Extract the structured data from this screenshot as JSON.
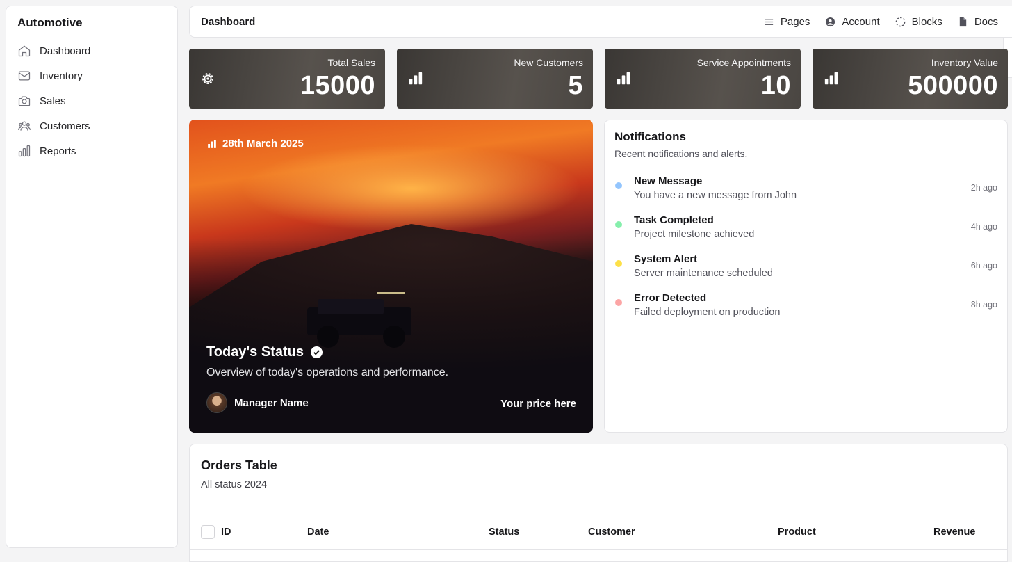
{
  "sidebar": {
    "brand": "Automotive",
    "items": [
      {
        "label": "Dashboard",
        "icon": "home-icon"
      },
      {
        "label": "Inventory",
        "icon": "mail-icon"
      },
      {
        "label": "Sales",
        "icon": "camera-icon"
      },
      {
        "label": "Customers",
        "icon": "users-icon"
      },
      {
        "label": "Reports",
        "icon": "bar-chart-icon"
      }
    ]
  },
  "topbar": {
    "title": "Dashboard",
    "links": [
      {
        "label": "Pages",
        "icon": "menu-icon"
      },
      {
        "label": "Account",
        "icon": "user-circle-icon"
      },
      {
        "label": "Blocks",
        "icon": "dashed-circle-icon"
      },
      {
        "label": "Docs",
        "icon": "file-icon"
      }
    ]
  },
  "stats": [
    {
      "label": "Total Sales",
      "value": "15000",
      "icon": "gear-icon"
    },
    {
      "label": "New Customers",
      "value": "5",
      "icon": "bar-chart-icon"
    },
    {
      "label": "Service Appointments",
      "value": "10",
      "icon": "bar-chart-icon"
    },
    {
      "label": "Inventory Value",
      "value": "500000",
      "icon": "bar-chart-icon"
    }
  ],
  "hero": {
    "date": "28th March 2025",
    "title": "Today's Status",
    "subtitle": "Overview of today's operations and performance.",
    "manager": "Manager Name",
    "price": "Your price here"
  },
  "notifications": {
    "title": "Notifications",
    "subtitle": "Recent notifications and alerts.",
    "items": [
      {
        "title": "New Message",
        "desc": "You have a new message from John",
        "time": "2h ago",
        "color": "#93c5fd"
      },
      {
        "title": "Task Completed",
        "desc": "Project milestone achieved",
        "time": "4h ago",
        "color": "#86efac"
      },
      {
        "title": "System Alert",
        "desc": "Server maintenance scheduled",
        "time": "6h ago",
        "color": "#fde047"
      },
      {
        "title": "Error Detected",
        "desc": "Failed deployment on production",
        "time": "8h ago",
        "color": "#fca5a5"
      }
    ]
  },
  "orders": {
    "title": "Orders Table",
    "subtitle": "All status 2024",
    "columns": [
      "ID",
      "Date",
      "Status",
      "Customer",
      "Product",
      "Revenue"
    ]
  }
}
